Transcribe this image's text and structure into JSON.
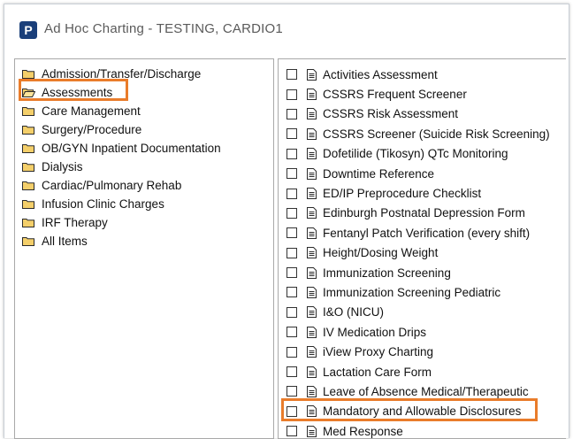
{
  "window": {
    "title": "Ad Hoc Charting - TESTING, CARDIO1",
    "app_icon_letter": "P"
  },
  "folders": [
    {
      "label": "Admission/Transfer/Discharge",
      "open": false
    },
    {
      "label": "Assessments",
      "open": true,
      "highlighted": true
    },
    {
      "label": "Care Management",
      "open": false
    },
    {
      "label": "Surgery/Procedure",
      "open": false
    },
    {
      "label": "OB/GYN Inpatient Documentation",
      "open": false
    },
    {
      "label": "Dialysis",
      "open": false
    },
    {
      "label": "Cardiac/Pulmonary Rehab",
      "open": false
    },
    {
      "label": "Infusion Clinic Charges",
      "open": false
    },
    {
      "label": "IRF Therapy",
      "open": false
    },
    {
      "label": "All Items",
      "open": false
    }
  ],
  "documents": [
    {
      "label": "Activities Assessment"
    },
    {
      "label": "CSSRS Frequent Screener"
    },
    {
      "label": "CSSRS Risk Assessment"
    },
    {
      "label": "CSSRS Screener (Suicide Risk Screening)"
    },
    {
      "label": "Dofetilide (Tikosyn) QTc Monitoring"
    },
    {
      "label": "Downtime Reference"
    },
    {
      "label": "ED/IP Preprocedure Checklist"
    },
    {
      "label": "Edinburgh Postnatal Depression Form"
    },
    {
      "label": "Fentanyl Patch Verification (every shift)"
    },
    {
      "label": "Height/Dosing Weight"
    },
    {
      "label": "Immunization Screening"
    },
    {
      "label": "Immunization Screening Pediatric"
    },
    {
      "label": "I&O (NICU)"
    },
    {
      "label": "IV Medication Drips"
    },
    {
      "label": "iView Proxy Charting"
    },
    {
      "label": "Lactation Care Form"
    },
    {
      "label": "Leave of Absence Medical/Therapeutic"
    },
    {
      "label": "Mandatory and Allowable Disclosures",
      "highlighted": true
    },
    {
      "label": "Med Response"
    }
  ],
  "colors": {
    "highlight": "#e97c2b",
    "folder": "#d9a53a",
    "app_icon": "#1a3f7a"
  }
}
